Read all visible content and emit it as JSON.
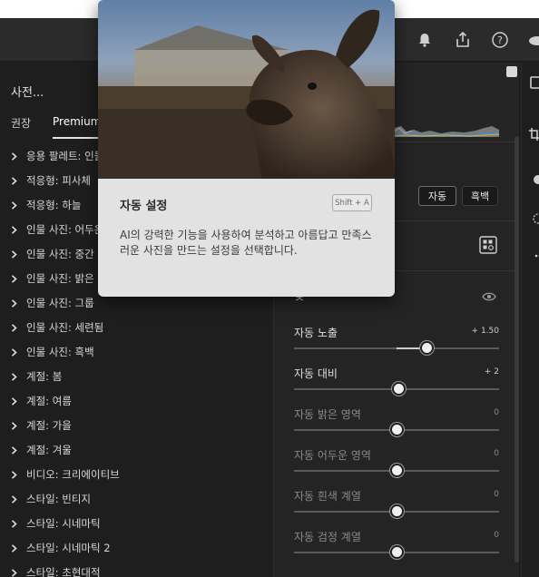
{
  "left_panel": {
    "title": "사전...",
    "tabs": [
      "권장",
      "Premium"
    ],
    "active_tab": 1,
    "items": [
      "응용 팔레트: 인물",
      "적응형: 피사체",
      "적응형: 하늘",
      "인물 사진: 어두운",
      "인물 사진: 중간",
      "인물 사진: 밝은",
      "인물 사진: 그룹",
      "인물 사진: 세련됨",
      "인물 사진: 흑백",
      "계절: 봄",
      "계절: 여름",
      "계절: 가을",
      "계절: 겨울",
      "비디오: 크리에이티브",
      "스타일: 빈티지",
      "스타일: 시네마틱",
      "스타일: 시네마틱 2",
      "스타일: 초현대적"
    ]
  },
  "edit_panel": {
    "auto_button": "자동",
    "bw_button": "흑백",
    "light_section_label": "빛",
    "sliders": [
      {
        "label": "자동 노출",
        "value": "+ 1.50",
        "position": 0.65,
        "dim": false
      },
      {
        "label": "자동 대비",
        "value": "+ 2",
        "position": 0.51,
        "dim": false
      },
      {
        "label": "자동 밝은 영역",
        "value": "0",
        "position": 0.5,
        "dim": true
      },
      {
        "label": "자동 어두운 영역",
        "value": "0",
        "position": 0.5,
        "dim": true
      },
      {
        "label": "자동 흰색 계열",
        "value": "0",
        "position": 0.5,
        "dim": true
      },
      {
        "label": "자동 검정 계열",
        "value": "0",
        "position": 0.5,
        "dim": true
      }
    ]
  },
  "tooltip": {
    "title": "자동 설정",
    "shortcut": "Shift + A",
    "description": "AI의 강력한 기능을 사용하여 분석하고 아름답고 만족스러운 사진을 만드는 설정을 선택합니다."
  },
  "topbar_icons": [
    "bell-icon",
    "share-icon",
    "help-icon",
    "cloud-icon"
  ],
  "colors": {
    "panel_bg": "#1e1e1e",
    "edit_bg": "#242424",
    "tooltip_bg": "#e2e2e2"
  }
}
